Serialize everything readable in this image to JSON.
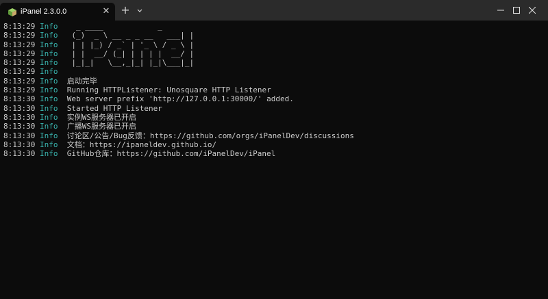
{
  "window": {
    "tab_title": "iPanel 2.3.0.0",
    "accent": "#3ab6b0",
    "background": "#0c0c0c",
    "titlebar": "#2b2b2b"
  },
  "icons": {
    "app": "cube-icon",
    "close_tab": "close-icon",
    "new_tab": "plus-icon",
    "dropdown": "chevron-down-icon",
    "minimize": "minimize-icon",
    "maximize": "maximize-icon",
    "close_window": "close-icon"
  },
  "log": [
    {
      "time": "8:13:29",
      "level": "Info",
      "text": "  _ ____            _"
    },
    {
      "time": "8:13:29",
      "level": "Info",
      "text": " (_)  _ \\ __ _ _ __   ___| |"
    },
    {
      "time": "8:13:29",
      "level": "Info",
      "text": " | | |_) / _` | '_ \\ / _ \\ |"
    },
    {
      "time": "8:13:29",
      "level": "Info",
      "text": " | |  __/ (_| | | | |  __/ |"
    },
    {
      "time": "8:13:29",
      "level": "Info",
      "text": " |_|_|   \\__,_|_| |_|\\___|_|"
    },
    {
      "time": "8:13:29",
      "level": "Info",
      "text": ""
    },
    {
      "time": "8:13:29",
      "level": "Info",
      "text": "启动完毕"
    },
    {
      "time": "8:13:29",
      "level": "Info",
      "text": "Running HTTPListener: Unosquare HTTP Listener"
    },
    {
      "time": "8:13:30",
      "level": "Info",
      "text": "Web server prefix 'http://127.0.0.1:30000/' added."
    },
    {
      "time": "8:13:30",
      "level": "Info",
      "text": "Started HTTP Listener"
    },
    {
      "time": "8:13:30",
      "level": "Info",
      "text": "实例WS服务器已开启"
    },
    {
      "time": "8:13:30",
      "level": "Info",
      "text": "广播WS服务器已开启"
    },
    {
      "time": "8:13:30",
      "level": "Info",
      "text": "讨论区/公告/Bug反馈：https://github.com/orgs/iPanelDev/discussions"
    },
    {
      "time": "8:13:30",
      "level": "Info",
      "text": "文档：https://ipaneldev.github.io/"
    },
    {
      "time": "8:13:30",
      "level": "Info",
      "text": "GitHub仓库：https://github.com/iPanelDev/iPanel"
    }
  ]
}
